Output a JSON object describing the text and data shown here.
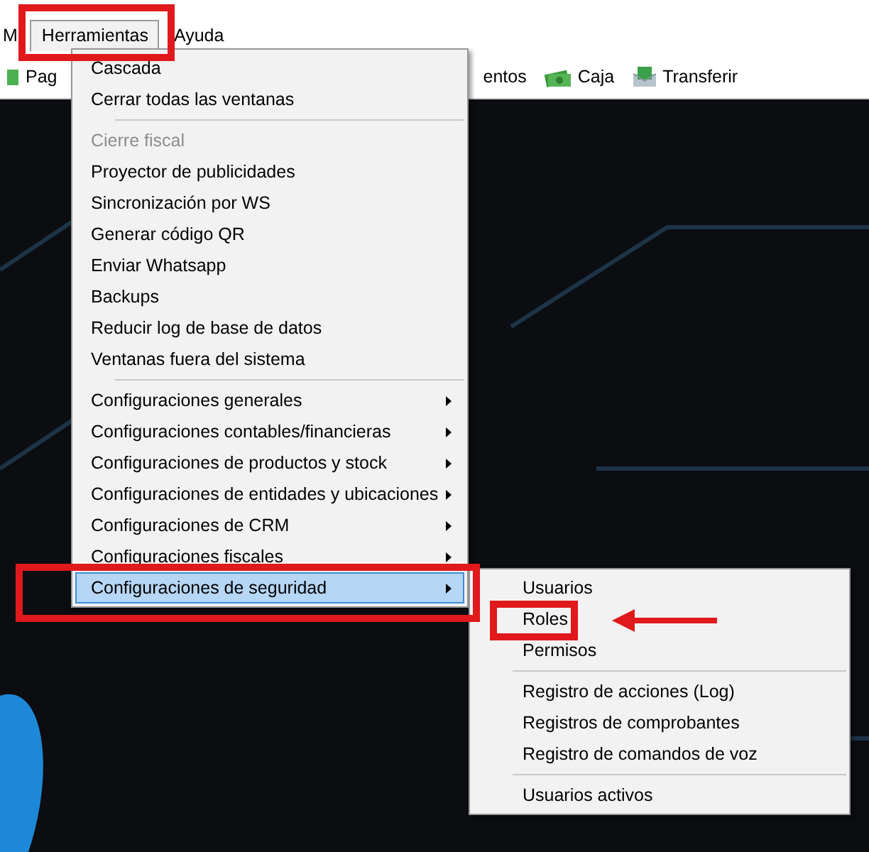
{
  "menu_bar": [
    {
      "label": "M",
      "selected": false
    },
    {
      "label": "Herramientas",
      "selected": true
    },
    {
      "label": "Ayuda",
      "selected": false
    }
  ],
  "toolbar": [
    {
      "label": "Pag"
    },
    {
      "label": "entos"
    },
    {
      "label": "Caja"
    },
    {
      "label": "Transferir"
    }
  ],
  "menu": [
    {
      "kind": "item",
      "label": "Cascada",
      "disabled": false,
      "submenu": false,
      "selected": false
    },
    {
      "kind": "item",
      "label": "Cerrar todas las ventanas",
      "disabled": false,
      "submenu": false,
      "selected": false
    },
    {
      "kind": "separator"
    },
    {
      "kind": "item",
      "label": "Cierre fiscal",
      "disabled": true,
      "submenu": false,
      "selected": false
    },
    {
      "kind": "item",
      "label": "Proyector de publicidades",
      "disabled": false,
      "submenu": false,
      "selected": false
    },
    {
      "kind": "item",
      "label": "Sincronización por WS",
      "disabled": false,
      "submenu": false,
      "selected": false
    },
    {
      "kind": "item",
      "label": "Generar código QR",
      "disabled": false,
      "submenu": false,
      "selected": false
    },
    {
      "kind": "item",
      "label": "Enviar Whatsapp",
      "disabled": false,
      "submenu": false,
      "selected": false
    },
    {
      "kind": "item",
      "label": "Backups",
      "disabled": false,
      "submenu": false,
      "selected": false
    },
    {
      "kind": "item",
      "label": "Reducir log de base de datos",
      "disabled": false,
      "submenu": false,
      "selected": false
    },
    {
      "kind": "item",
      "label": "Ventanas fuera del sistema",
      "disabled": false,
      "submenu": false,
      "selected": false
    },
    {
      "kind": "separator"
    },
    {
      "kind": "item",
      "label": "Configuraciones generales",
      "disabled": false,
      "submenu": true,
      "selected": false
    },
    {
      "kind": "item",
      "label": "Configuraciones contables/financieras",
      "disabled": false,
      "submenu": true,
      "selected": false
    },
    {
      "kind": "item",
      "label": "Configuraciones de productos y stock",
      "disabled": false,
      "submenu": true,
      "selected": false
    },
    {
      "kind": "item",
      "label": "Configuraciones de entidades y ubicaciones",
      "disabled": false,
      "submenu": true,
      "selected": false
    },
    {
      "kind": "item",
      "label": "Configuraciones de CRM",
      "disabled": false,
      "submenu": true,
      "selected": false
    },
    {
      "kind": "item",
      "label": "Configuraciones fiscales",
      "disabled": false,
      "submenu": true,
      "selected": false
    },
    {
      "kind": "item",
      "label": "Configuraciones de seguridad",
      "disabled": false,
      "submenu": true,
      "selected": true
    }
  ],
  "submenu": [
    {
      "kind": "item",
      "label": "Usuarios"
    },
    {
      "kind": "item",
      "label": "Roles"
    },
    {
      "kind": "item",
      "label": "Permisos"
    },
    {
      "kind": "separator"
    },
    {
      "kind": "item",
      "label": "Registro de acciones (Log)"
    },
    {
      "kind": "item",
      "label": "Registros de comprobantes"
    },
    {
      "kind": "item",
      "label": "Registro de comandos de voz"
    },
    {
      "kind": "separator"
    },
    {
      "kind": "item",
      "label": "Usuarios activos"
    }
  ]
}
